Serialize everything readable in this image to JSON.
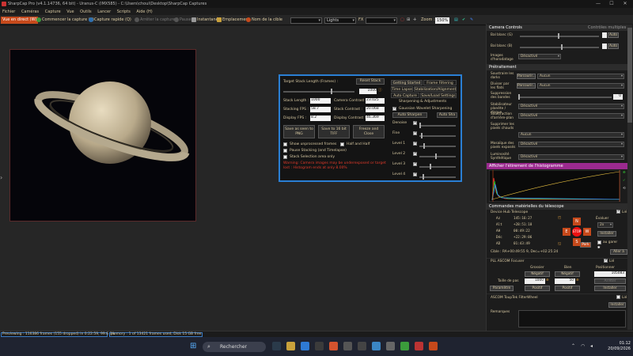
{
  "window": {
    "title": "SharpCap Pro (v4.1.14736, 64 bit) - Uranus-C (IMX585) - C:\\Users\\choui\\Desktop\\SharpCap Captures",
    "minimize": "—",
    "maximize": "☐",
    "close": "✕"
  },
  "menu": [
    "Fichier",
    "Caméras",
    "Capture",
    "Vue",
    "Outils",
    "Lancer",
    "Scripts",
    "Aide (H)"
  ],
  "toolbar": {
    "live_view": "Vue en direct (W)",
    "start_capture": "Commencer la capture (S)",
    "quick_capture": "Capture rapide (Q)",
    "stop_capture": "Arrêter la capture",
    "pause": "Pause",
    "snapshot": "Instantané",
    "location": "Emplacement",
    "target_label": "Nom de la cible",
    "target_value": "",
    "frame_type": "Lights",
    "fx_label": "FX",
    "fx_value": "",
    "zoom_label": "Zoom :",
    "zoom_value": "150%"
  },
  "colors": {
    "accent_orange": "#c6491b",
    "dialog_border": "#2a7fd4",
    "warning_red": "#e23a2a",
    "purple_header": "#9b2a8f"
  },
  "stack": {
    "target_label": "Target Stack Length (Frames) :",
    "reset_button": "Reset Stack",
    "target_value": "1000",
    "stack_length_label": "Stack Length :",
    "stack_length_value": "1000",
    "stacking_fps_label": "Stacking FPS :",
    "stacking_fps_value": "58.7",
    "display_fps_label": "Display FPS :",
    "display_fps_value": "8.2",
    "camera_contrast_label": "Camera Contrast :",
    "camera_contrast_value": "23.025",
    "stack_contrast_label": "Stack Contrast :",
    "stack_contrast_value": "20.068",
    "display_contrast_label": "Display Contrast :",
    "display_contrast_value": "46.369",
    "save_png": "Save as seen to PNG",
    "save_tiff": "Save to 16 bit TIFF",
    "freeze_close": "Freeze and Close",
    "show_unprocessed": "Show unprocessed frames",
    "half_and_half": "Half and Half",
    "pause_stacking": "Pause Stacking (and Timelapse)",
    "stack_selection": "Stack Selection area only",
    "warning": "Warning: Camera images may be underexposed or target lost : Histogram ends at only 8.00%",
    "tabs": [
      "Getting Started",
      "Frame Filtering",
      "Time Lapse",
      "Stabilization/Alignment",
      "Auto Capture",
      "Save/Load Settings"
    ],
    "sharpening_title": "Sharpening & Adjustments",
    "wavelet_label": "Gaussian Wavelet Sharpening",
    "auto_sharpen": "Auto Sharpen",
    "auto_sharpen_2": "Auto Sha",
    "levels": [
      "Denoise",
      "Fine",
      "Level 1",
      "Level 2",
      "Level 3",
      "Level 4"
    ],
    "level_positions": [
      0.0,
      0.05,
      0.12,
      0.45,
      0.3,
      0.1
    ]
  },
  "panel": {
    "camera_controls": "Camera Controls",
    "remove_unused": "Contrôles multiples",
    "bal_blue_label": "Bal blanc (G)",
    "bal_blue_value": "",
    "bal_b_label": "Bal blanc (B)",
    "bal_b_value": "",
    "auto": "Auto",
    "image_sharpening_label": "Images d'horodatage",
    "image_sharpening_value": "Désactivé",
    "preprocessing": "Prétraitement",
    "subtract_dark_label": "Soustraire les darks",
    "browse": "Parcourir...",
    "none": "Aucun",
    "divide_flat_label": "Diviser par les flats",
    "banding_label": "Suppression des bandes",
    "banding_value": "0",
    "stabilize_label": "Stabilisateur planète / disque",
    "stabilize_value": "Désactivé",
    "subtract_bg_label": "Soustraction d'arrière-plan",
    "subtract_bg_value": "Désactivé",
    "hot_pixels_label": "Supprimer les pixels chauds",
    "hot_pixels_value": "Aucun",
    "bin_label": "Mosaïque des pixels exposés",
    "bin_value": "Désactivé",
    "luminosity_label": "Luminosité Synthétique",
    "luminosity_value": "Désactivé",
    "histogram_title": "Afficher l'étirement de l'histogramme",
    "telescope_title": "Commandes matérielles du télescope",
    "mount_label": "Device Hub Telescope",
    "mount_link": "Lié",
    "az_label": "Az",
    "az_value": "145:16:27",
    "alt_label": "Alt",
    "alt_value": "+28:51:18",
    "ah_label": "AH",
    "ah_value": "00:49:22",
    "dec_label": "Déc",
    "dec_value": "+22:29:06",
    "ad_label": "AD",
    "ad_value": "01:43:49",
    "evaluate_label": "Évaluer",
    "rate_value": "2x",
    "install": "Installer",
    "go_park": "au garer",
    "north": "N",
    "south": "S",
    "east": "E",
    "west": "W",
    "stop": "STOP",
    "park": "Park",
    "cible_label": "Cible :",
    "cible_value": "RA+00:49:55 9, Dec=+02:25:24",
    "vers_label": "Aller à",
    "focuser_title": "PLL ASCOM Focuser",
    "focuser_link": "Lié",
    "grossier": "Grossier",
    "bien": "Bien",
    "positionner": "Positionner",
    "negatif": "Négatif",
    "focus_position": "105083",
    "step_label": "Taille de pas",
    "step_coarse": "1000",
    "step_fine": "50",
    "arreter": "Arrêter",
    "positif": "Positif",
    "filterwheel_title": "ASCOM ToupTek FilterWheel",
    "filterwheel_link": "Lié",
    "install_2": "Installer",
    "remarks": "Remarques"
  },
  "status": {
    "previewing": "Previewing : 116386 frames (155 dropped) in 0:22:59, 99.6 fps",
    "memory": "Memory : 1 of 13421 frames used, Disk 15 GB free"
  },
  "taskbar": {
    "search": "Rechercher",
    "time": "01:12",
    "date": "20/09/2026"
  }
}
